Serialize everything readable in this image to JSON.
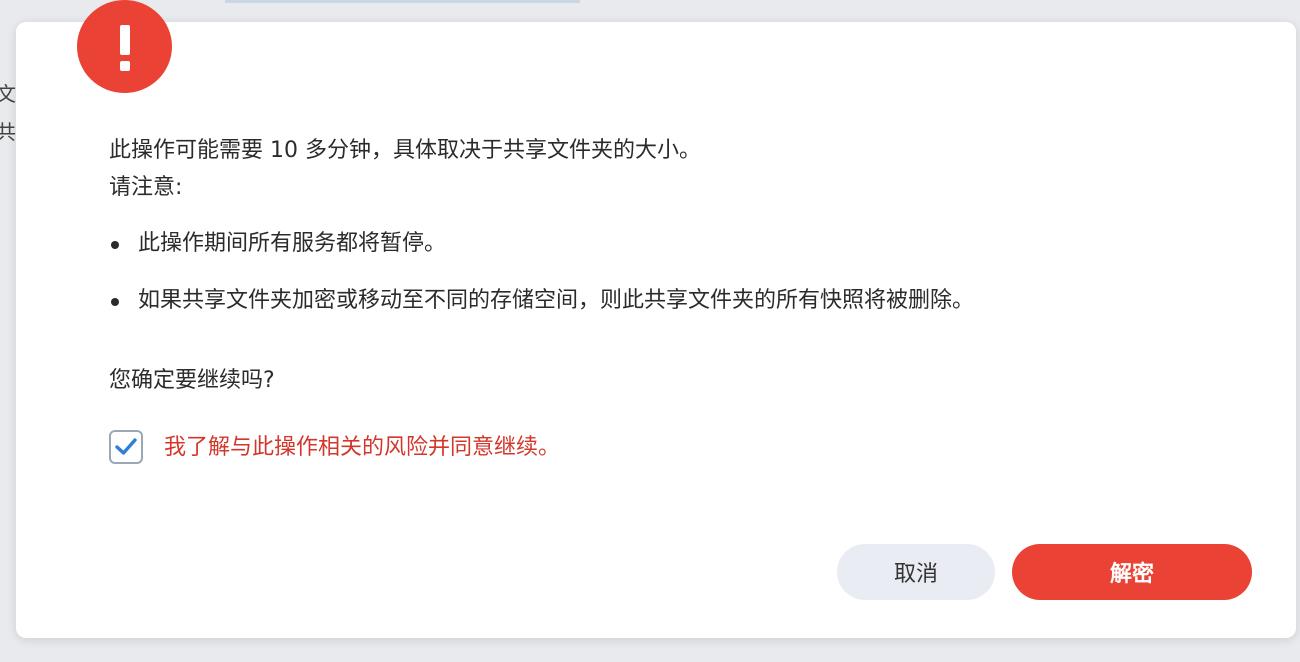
{
  "background": {
    "text_fragments": [
      "文",
      "共"
    ]
  },
  "dialog": {
    "icon": "exclamation-icon",
    "accent_color": "#ea4335",
    "message_line1": "此操作可能需要 10 多分钟，具体取决于共享文件夹的大小。",
    "message_line2": "请注意:",
    "bullets": [
      "此操作期间所有服务都将暂停。",
      "如果共享文件夹加密或移动至不同的存储空间，则此共享文件夹的所有快照将被删除。"
    ],
    "confirm_question": "您确定要继续吗?",
    "risk_checkbox": {
      "checked": true,
      "label": "我了解与此操作相关的风险并同意继续。"
    },
    "buttons": {
      "cancel": "取消",
      "primary": "解密"
    }
  }
}
